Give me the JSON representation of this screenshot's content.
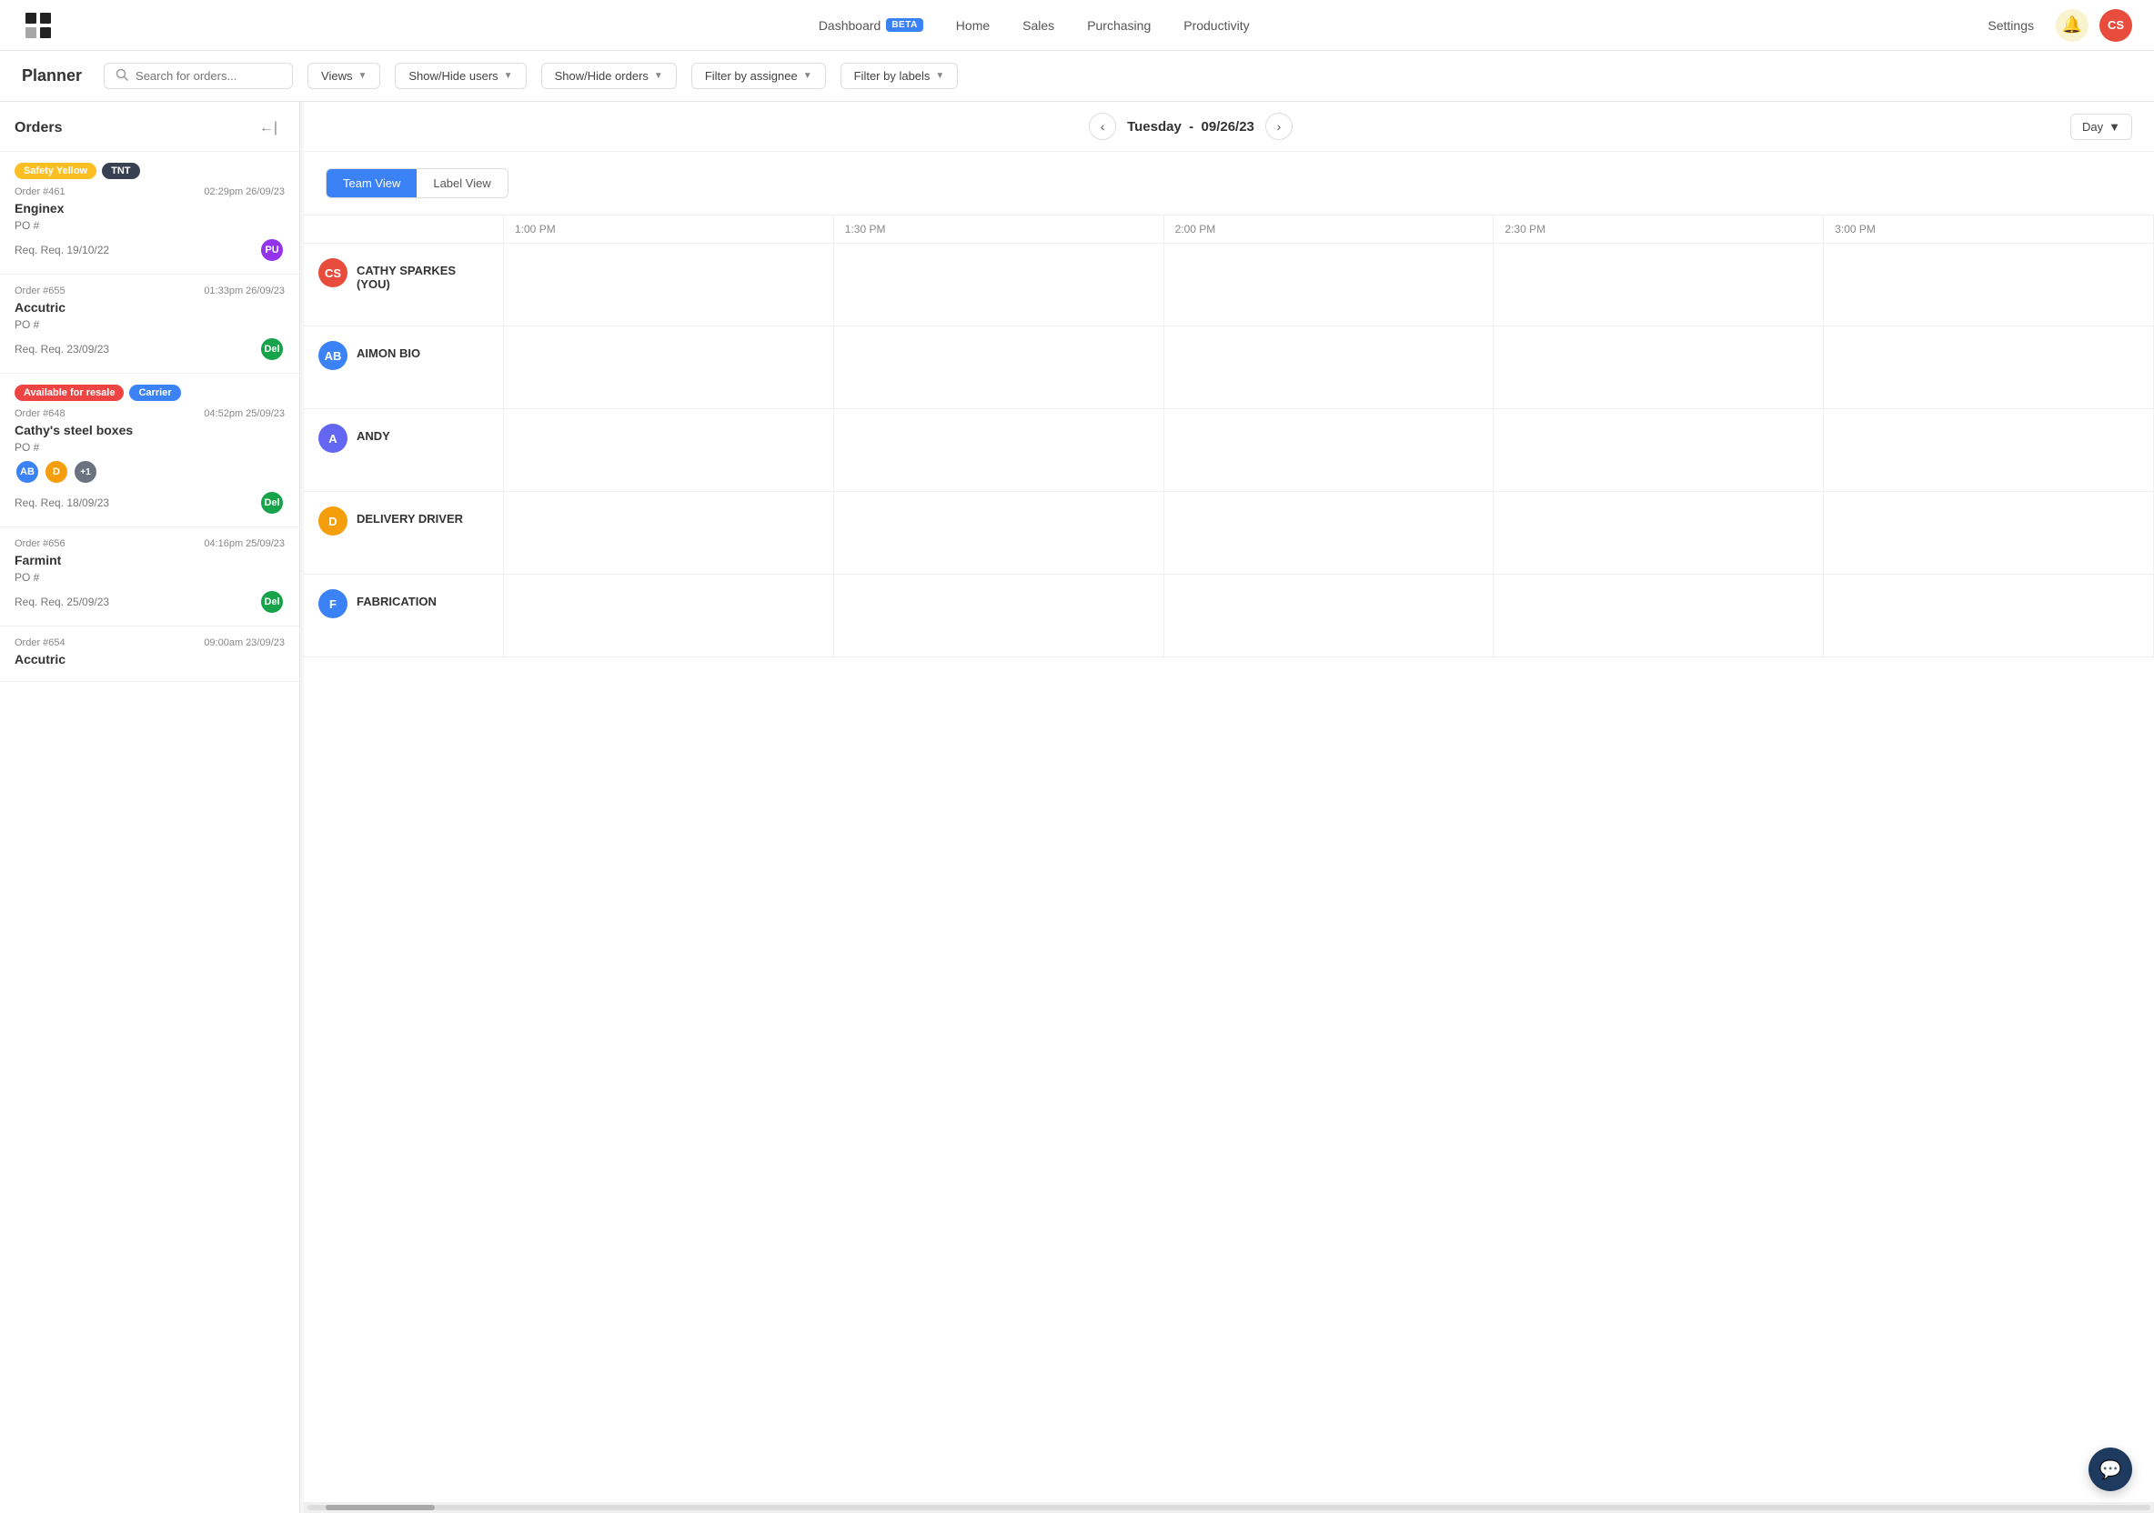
{
  "nav": {
    "logo_label": "Logo",
    "links": [
      {
        "id": "dashboard",
        "label": "Dashboard",
        "badge": "BETA",
        "active": true
      },
      {
        "id": "home",
        "label": "Home",
        "active": false
      },
      {
        "id": "sales",
        "label": "Sales",
        "active": false
      },
      {
        "id": "purchasing",
        "label": "Purchasing",
        "active": false
      },
      {
        "id": "productivity",
        "label": "Productivity",
        "active": false
      }
    ],
    "settings_label": "Settings",
    "notif_icon": "🔔",
    "avatar_initials": "CS"
  },
  "planner": {
    "title": "Planner",
    "search_placeholder": "Search for orders...",
    "filters": [
      {
        "id": "views",
        "label": "Views"
      },
      {
        "id": "show-hide-users",
        "label": "Show/Hide users"
      },
      {
        "id": "show-hide-orders",
        "label": "Show/Hide orders"
      },
      {
        "id": "filter-assignee",
        "label": "Filter by assignee"
      },
      {
        "id": "filter-labels",
        "label": "Filter by labels"
      }
    ]
  },
  "sidebar": {
    "title": "Orders",
    "orders": [
      {
        "id": "order-461",
        "tags": [
          {
            "label": "Safety Yellow",
            "type": "yellow"
          },
          {
            "label": "TNT",
            "type": "dark"
          }
        ],
        "number": "Order #461",
        "date": "02:29pm 26/09/23",
        "name": "Enginex",
        "po": "PO #",
        "req": "Req. Req. 19/10/22",
        "avatars": [
          {
            "initials": "PU",
            "type": "pu"
          }
        ]
      },
      {
        "id": "order-655",
        "tags": [],
        "number": "Order #655",
        "date": "01:33pm 26/09/23",
        "name": "Accutric",
        "po": "PO #",
        "req": "Req. Req. 23/09/23",
        "avatars": [
          {
            "initials": "Del",
            "type": "del"
          }
        ]
      },
      {
        "id": "order-648",
        "tags": [
          {
            "label": "Available for resale",
            "type": "red"
          },
          {
            "label": "Carrier",
            "type": "blue"
          }
        ],
        "number": "Order #648",
        "date": "04:52pm 25/09/23",
        "name": "Cathy's steel boxes",
        "po": "PO #",
        "req": "Req. Req. 18/09/23",
        "avatars": [
          {
            "initials": "AB",
            "type": "ab"
          },
          {
            "initials": "D",
            "type": "d"
          },
          {
            "initials": "+1",
            "type": "plus"
          }
        ],
        "footer_avatar": {
          "initials": "Del",
          "type": "del"
        }
      },
      {
        "id": "order-656",
        "tags": [],
        "number": "Order #656",
        "date": "04:16pm 25/09/23",
        "name": "Farmint",
        "po": "PO #",
        "req": "Req. Req. 25/09/23",
        "avatars": [
          {
            "initials": "Del",
            "type": "del"
          }
        ]
      },
      {
        "id": "order-654",
        "tags": [],
        "number": "Order #654",
        "date": "09:00am 23/09/23",
        "name": "Accutric",
        "po": "",
        "req": "",
        "avatars": []
      }
    ]
  },
  "calendar": {
    "nav": {
      "prev_label": "‹",
      "next_label": "›",
      "date_label": "Tuesday",
      "date_separator": "-",
      "date_value": "09/26/23"
    },
    "view_select": "Day",
    "tabs": [
      {
        "id": "team-view",
        "label": "Team View",
        "active": true
      },
      {
        "id": "label-view",
        "label": "Label View",
        "active": false
      }
    ],
    "time_slots": [
      {
        "label": "1:00 PM"
      },
      {
        "label": "1:30 PM"
      },
      {
        "label": "2:00 PM"
      },
      {
        "label": "2:30 PM"
      },
      {
        "label": "3:00 PM"
      }
    ],
    "users": [
      {
        "id": "cathy-sparkes",
        "initials": "CS",
        "avatar_type": "cs",
        "name": "CATHY SPARKES (YOU)"
      },
      {
        "id": "aimon-bio",
        "initials": "AB",
        "avatar_type": "ab2",
        "name": "AIMON BIO"
      },
      {
        "id": "andy",
        "initials": "A",
        "avatar_type": "a",
        "name": "ANDY"
      },
      {
        "id": "delivery-driver",
        "initials": "D",
        "avatar_type": "d2",
        "name": "DELIVERY DRIVER"
      },
      {
        "id": "fabrication",
        "initials": "F",
        "avatar_type": "f",
        "name": "FABRICATION"
      }
    ]
  },
  "chat": {
    "icon": "💬"
  }
}
